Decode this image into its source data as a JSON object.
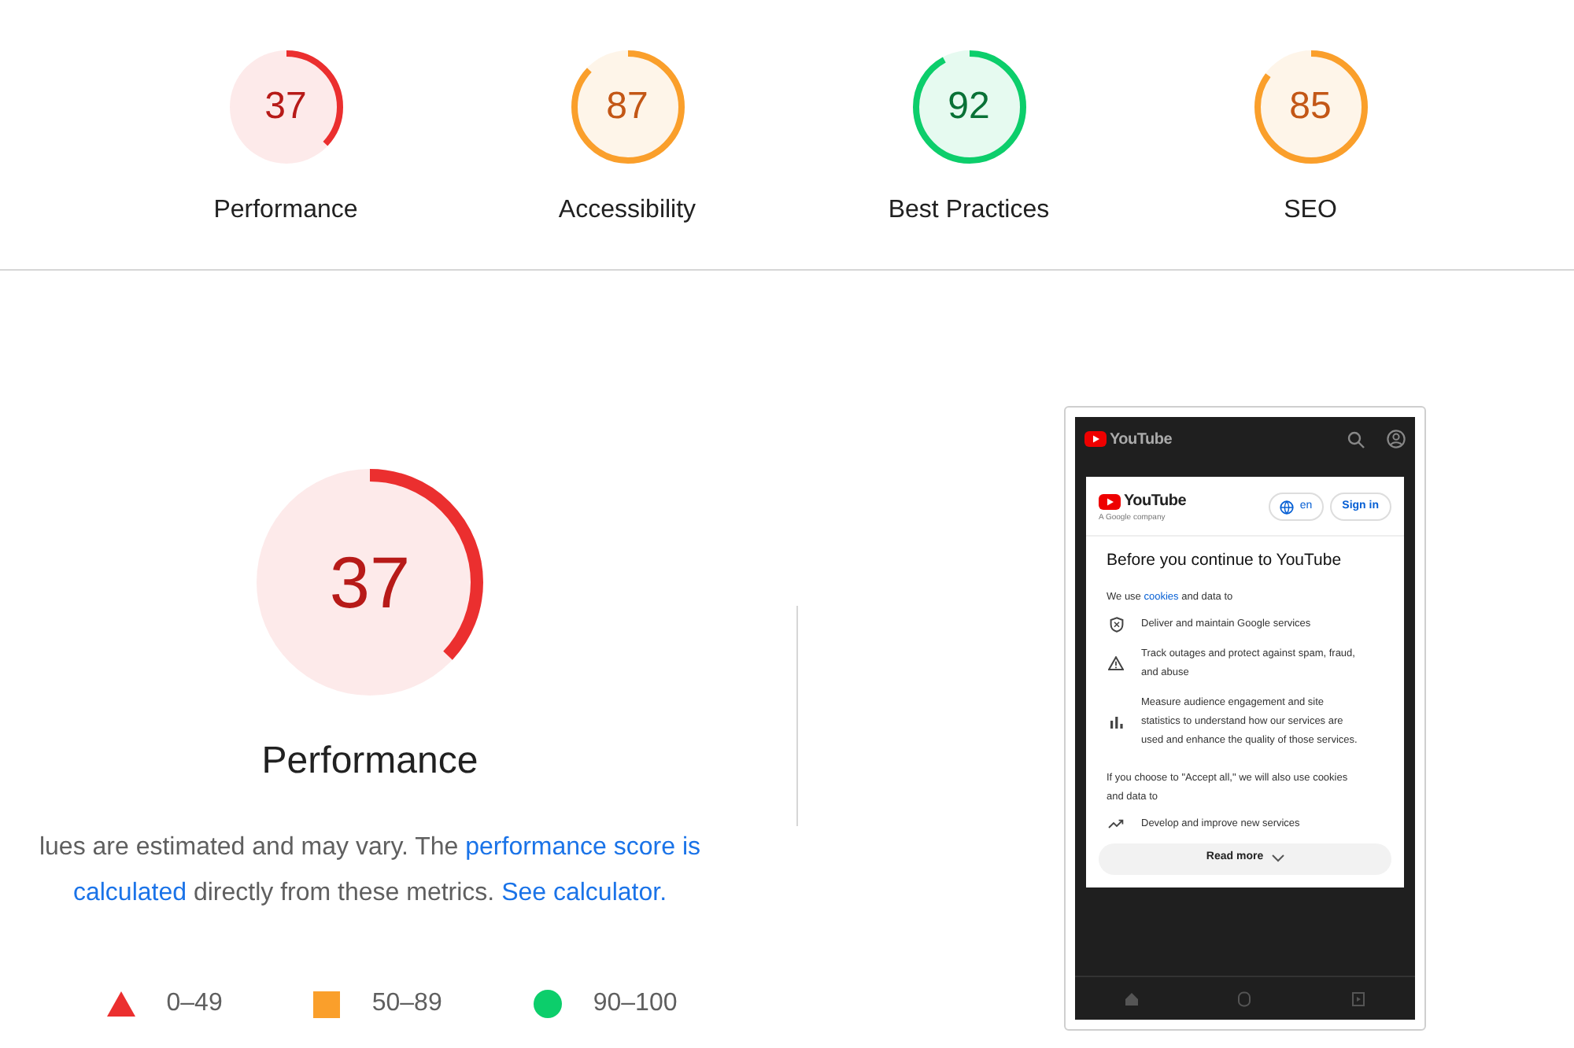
{
  "categories": [
    {
      "score": "37",
      "level": 0.37,
      "color": "#eb2f2f",
      "label": "Performance"
    },
    {
      "score": "87",
      "level": 0.87,
      "color": "#fa9f2b",
      "label": "Accessibility"
    },
    {
      "score": "92",
      "level": 0.92,
      "color": "#0cce6b",
      "label": "Best Practices"
    },
    {
      "score": "85",
      "level": 0.85,
      "color": "#fa9f2b",
      "label": "SEO"
    }
  ],
  "main_gauge": {
    "score": "37",
    "level": 0.37,
    "color": "#eb2f2f",
    "title": "Performance"
  },
  "description": {
    "lines": [
      [
        {
          "kind": "text",
          "text": "lues are estimated and may vary. The "
        },
        {
          "kind": "link",
          "text": "performance score is"
        }
      ],
      [
        {
          "kind": "link",
          "text": "calculated"
        },
        {
          "kind": "text",
          "text": " directly from these metrics. "
        },
        {
          "kind": "link",
          "text": "See calculator."
        }
      ]
    ]
  },
  "legend": [
    {
      "kind": "triangle",
      "color": "#eb2f2f",
      "label": "0–49"
    },
    {
      "kind": "square",
      "color": "#fa9f2b",
      "label": "50–89"
    },
    {
      "kind": "circle",
      "color": "#0cce6b",
      "label": "90–100"
    }
  ],
  "screenshot": {
    "app_title": "YouTube",
    "dialog": {
      "brand": "YouTube",
      "brand_sub": "A Google company",
      "language_button": "en",
      "sign_in_button": "Sign in",
      "heading": "Before you continue to YouTube",
      "intro": "We use **cookies** and data to",
      "items": [
        {
          "kind": "shield",
          "text": "Deliver and maintain Google services"
        },
        {
          "kind": "warning",
          "text": "Track outages and protect against spam, fraud, and abuse"
        },
        {
          "kind": "chart",
          "text": "Measure audience engagement and site statistics to understand how our services are used and enhance the quality of those services."
        }
      ],
      "accept_note": "If you choose to \"Accept all,\" we will also use cookies and data to",
      "extra_items": [
        {
          "kind": "trend",
          "text": "Develop and improve new services"
        }
      ],
      "read_more_button": "Read more"
    }
  }
}
